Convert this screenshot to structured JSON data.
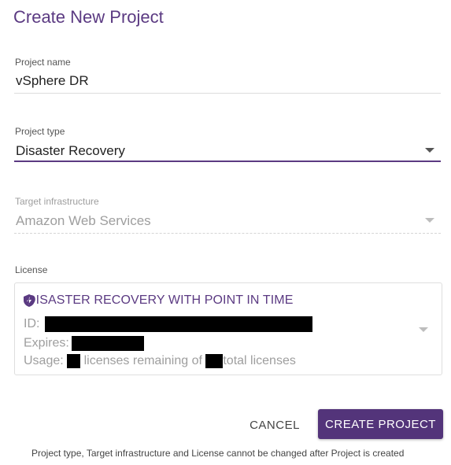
{
  "dialog": {
    "title": "Create New Project"
  },
  "fields": {
    "project_name": {
      "label": "Project name",
      "value": "vSphere DR"
    },
    "project_type": {
      "label": "Project type",
      "value": "Disaster Recovery"
    },
    "target_infrastructure": {
      "label": "Target infrastructure",
      "value": "Amazon Web Services"
    },
    "license": {
      "label": "License",
      "title": "DISASTER RECOVERY WITH POINT IN TIME",
      "id_label": "ID:",
      "expires_label": "Expires:",
      "usage_label": "Usage:",
      "usage_mid": "licenses remaining of",
      "usage_end": "total licenses",
      "icon": "shield-icon"
    }
  },
  "actions": {
    "cancel_label": "CANCEL",
    "create_label": "CREATE PROJECT"
  },
  "footnote": "Project type, Target infrastructure and License cannot be changed after Project is created",
  "colors": {
    "accent": "#5b3a82",
    "button": "#53347a"
  }
}
